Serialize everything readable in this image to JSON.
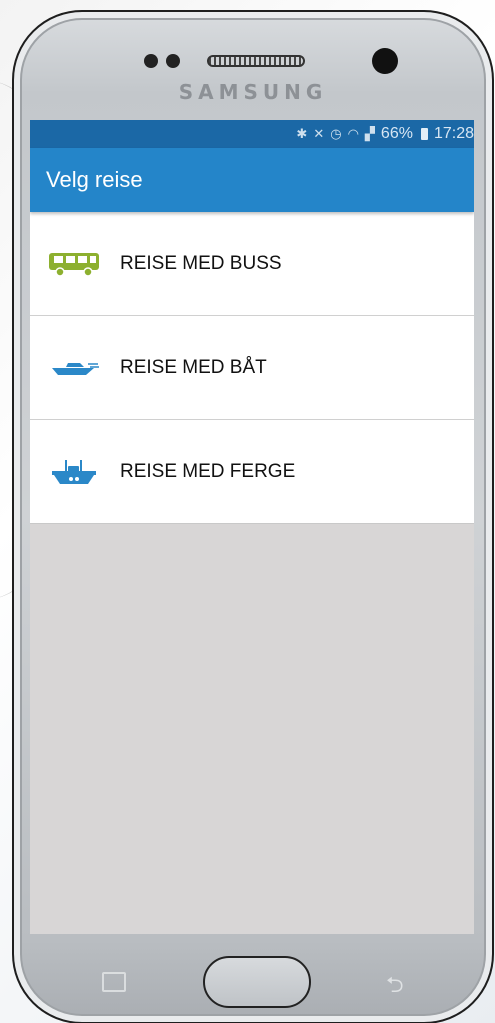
{
  "device": {
    "brand": "SAMSUNG"
  },
  "status_bar": {
    "icons": [
      "bluetooth-icon",
      "mute-icon",
      "alarm-icon",
      "wifi-icon",
      "signal-icon"
    ],
    "battery": "66%",
    "time": "17:28"
  },
  "app_bar": {
    "title": "Velg reise"
  },
  "menu": {
    "items": [
      {
        "label": "REISE MED BUSS",
        "icon": "bus-icon"
      },
      {
        "label": "REISE MED BÅT",
        "icon": "boat-icon"
      },
      {
        "label": "REISE MED FERGE",
        "icon": "ferry-icon"
      }
    ]
  },
  "colors": {
    "status_bar": "#1b68a6",
    "app_bar": "#2485c9",
    "bus_icon": "#8db02f",
    "boat_icon": "#2b88c8",
    "empty_area": "#d8d6d6"
  }
}
